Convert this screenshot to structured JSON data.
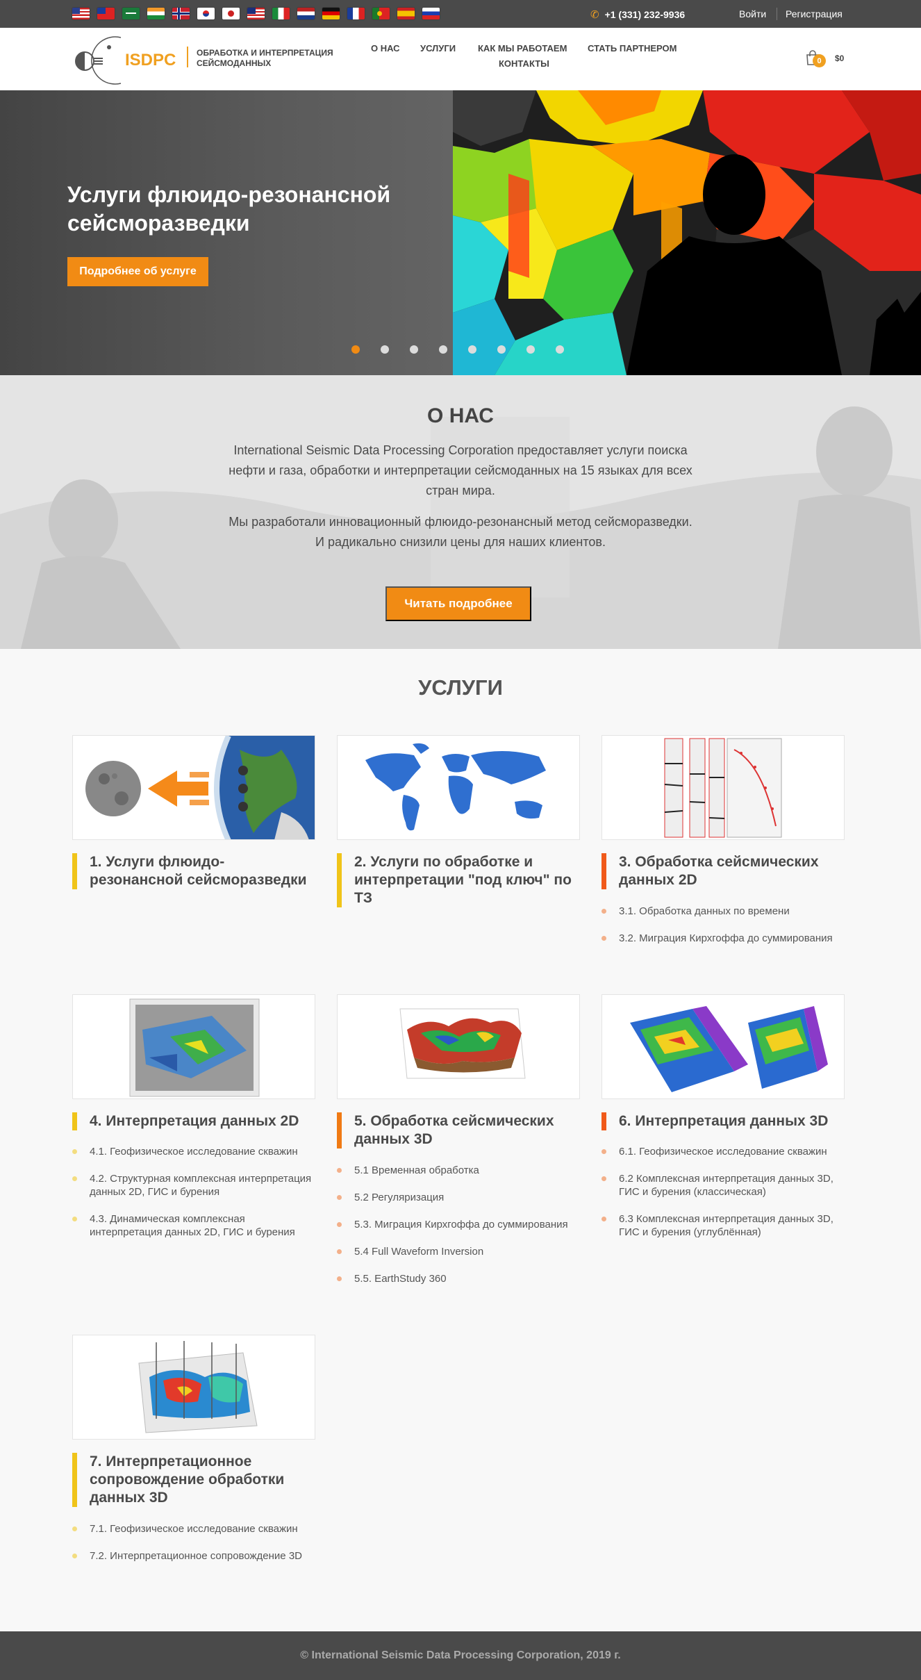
{
  "topbar": {
    "flags": [
      "us-flag",
      "taiwan-flag",
      "saudi-flag",
      "india-flag",
      "norway-flag",
      "korea-flag",
      "japan-flag",
      "malaysia-flag",
      "italy-flag",
      "netherlands-flag",
      "germany-flag",
      "france-flag",
      "portugal-flag",
      "spain-flag",
      "russia-flag"
    ],
    "phone": "+1 (331) 232-9936",
    "login": "Войти",
    "register": "Регистрация"
  },
  "header": {
    "logo_text": "ISDPC",
    "tagline_line1": "ОБРАБОТКА И ИНТЕРПРЕТАЦИЯ",
    "tagline_line2": "СЕЙСМОДАННЫХ",
    "nav": [
      "О НАС",
      "УСЛУГИ",
      "КАК МЫ РАБОТАЕМ",
      "СТАТЬ ПАРТНЕРОМ",
      "КОНТАКТЫ"
    ],
    "cart_count": "0",
    "cart_total": "$0"
  },
  "hero": {
    "title_line1": "Услуги флюидо-резонансной",
    "title_line2": "сейсморазведки",
    "button": "Подробнее об услуге",
    "slides_count": 8,
    "active_slide": 0
  },
  "about": {
    "title": "О НАС",
    "p1_line1": "International Seismic Data Processing Corporation предоставляет услуги поиска",
    "p1_line2": "нефти и газа, обработки и интерпретации сейсмоданных на 15 языках для всех",
    "p1_line3": "стран мира.",
    "p2_line1": "Мы разработали инновационный флюидо-резонансный метод сейсморазведки.",
    "p2_line2": "И радикально снизили цены для наших клиентов.",
    "button": "Читать подробнее"
  },
  "services": {
    "title": "УСЛУГИ",
    "cards": [
      {
        "title": "1. Услуги флюидо-резонансной сейсморазведки",
        "items": []
      },
      {
        "title": "2. Услуги по обработке и интерпретации \"под ключ\" по ТЗ",
        "items": []
      },
      {
        "title": "3. Обработка сейсмических данных 2D",
        "items": [
          "3.1. Обработка данных по времени",
          "3.2. Миграция Кирхгоффа до суммирования"
        ]
      },
      {
        "title": "4. Интерпретация данных 2D",
        "items": [
          "4.1. Геофизическое исследование скважин",
          "4.2. Структурная комплексная интерпретация данных 2D, ГИС и бурения",
          "4.3. Динамическая комплексная интерпретация данных 2D, ГИС и бурения"
        ]
      },
      {
        "title": "5. Обработка сейсмических данных 3D",
        "items": [
          "5.1 Временная обработка",
          "5.2 Регуляризация",
          "5.3. Миграция Кирхгоффа до суммирования",
          "5.4 Full Waveform Inversion",
          "5.5. EarthStudy 360"
        ]
      },
      {
        "title": "6. Интерпретация данных 3D",
        "items": [
          "6.1. Геофизическое исследование скважин",
          "6.2 Комплексная интерпретация данных 3D, ГИС и бурения (классическая)",
          "6.3 Комплексная интерпретация данных 3D, ГИС и бурения (углублённая)"
        ]
      },
      {
        "title": "7. Интерпретационное сопровождение обработки данных 3D",
        "items": [
          "7.1. Геофизическое исследование скважин",
          "7.2. Интерпретационное сопровождение 3D"
        ]
      }
    ]
  },
  "footer": {
    "copyright": "© International Seismic Data Processing Corporation, 2019 г."
  },
  "colors": {
    "accent": "#f18b14",
    "bar_yellow": "#f0c419",
    "bar_orange": "#f07a14",
    "bar_red_orange": "#f05a1a",
    "topbar": "#4a4a4a"
  }
}
